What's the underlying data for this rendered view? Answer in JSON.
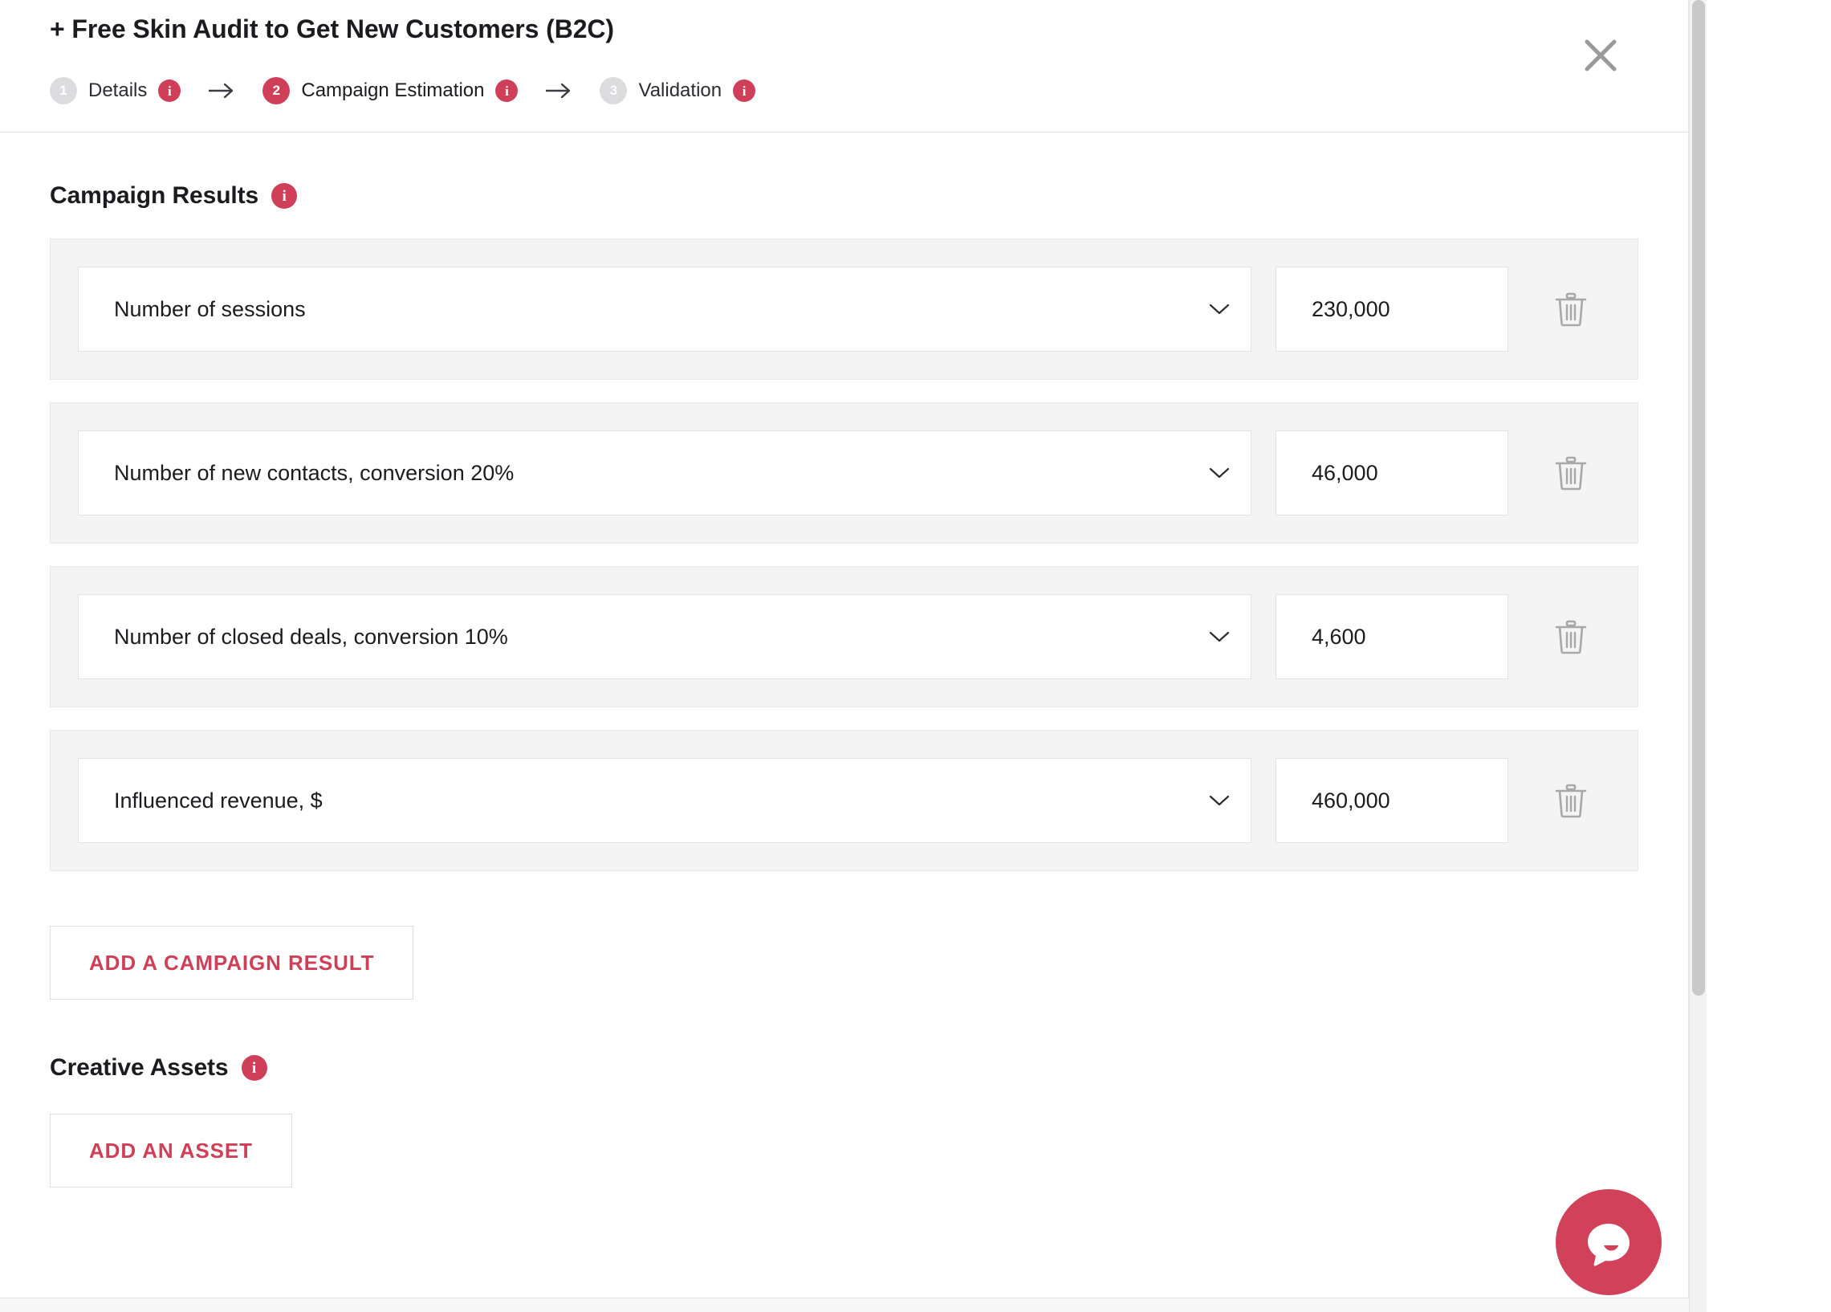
{
  "header": {
    "title": "+ Free Skin Audit to Get New Customers (B2C)",
    "close_icon": "close-icon",
    "steps": [
      {
        "number": "1",
        "label": "Details",
        "active": false,
        "info": "i"
      },
      {
        "number": "2",
        "label": "Campaign Estimation",
        "active": true,
        "info": "i"
      },
      {
        "number": "3",
        "label": "Validation",
        "active": false,
        "info": "i"
      }
    ],
    "arrow": "→"
  },
  "campaign_results": {
    "section_label": "Campaign Results",
    "info": "i",
    "rows": [
      {
        "metric": "Number of sessions",
        "value": "230,000"
      },
      {
        "metric": "Number of new contacts, conversion 20%",
        "value": "46,000"
      },
      {
        "metric": "Number of closed deals, conversion 10%",
        "value": "4,600"
      },
      {
        "metric": "Influenced revenue, $",
        "value": "460,000"
      }
    ],
    "add_button_label": "ADD A CAMPAIGN RESULT"
  },
  "creative_assets": {
    "section_label": "Creative Assets",
    "info": "i",
    "add_button_label": "ADD AN ASSET"
  },
  "chat": {
    "icon": "chat-bubble-icon"
  },
  "colors": {
    "accent": "#cf3f58",
    "chat": "#d2415a",
    "text": "#1b1b20",
    "row_bg": "#f4f4f5",
    "muted": "#dcdcde"
  }
}
